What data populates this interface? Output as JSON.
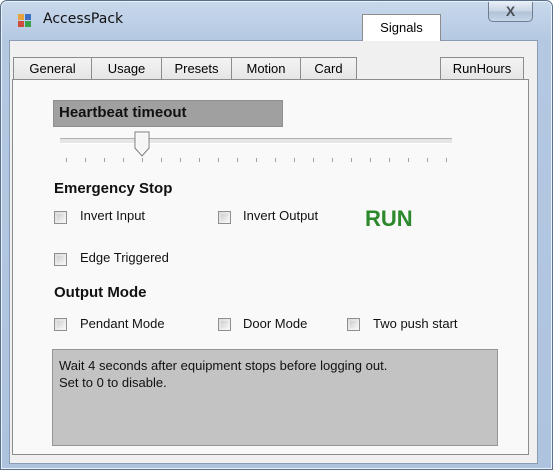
{
  "window": {
    "title": "AccessPack",
    "close_glyph": "X",
    "icon": "app-grid-icon"
  },
  "tabs": [
    {
      "label": "General"
    },
    {
      "label": "Usage"
    },
    {
      "label": "Presets"
    },
    {
      "label": "Motion"
    },
    {
      "label": "Card"
    },
    {
      "label": "Signals",
      "active": true
    },
    {
      "label": "RunHours"
    }
  ],
  "signals": {
    "heartbeat": {
      "label": "Heartbeat timeout",
      "value": 4,
      "max": 20
    },
    "emergency_stop": {
      "label": "Emergency Stop",
      "invert_input": "Invert Input",
      "invert_output": "Invert Output",
      "edge_triggered": "Edge Triggered",
      "status": "RUN",
      "status_color": "#2c8a2c"
    },
    "output_mode": {
      "label": "Output Mode",
      "pendant_mode": "Pendant Mode",
      "door_mode": "Door Mode",
      "two_push_start": "Two push start"
    },
    "info_line1": "Wait  4 seconds after equipment stops before logging out.",
    "info_line2": "Set to 0 to disable."
  }
}
